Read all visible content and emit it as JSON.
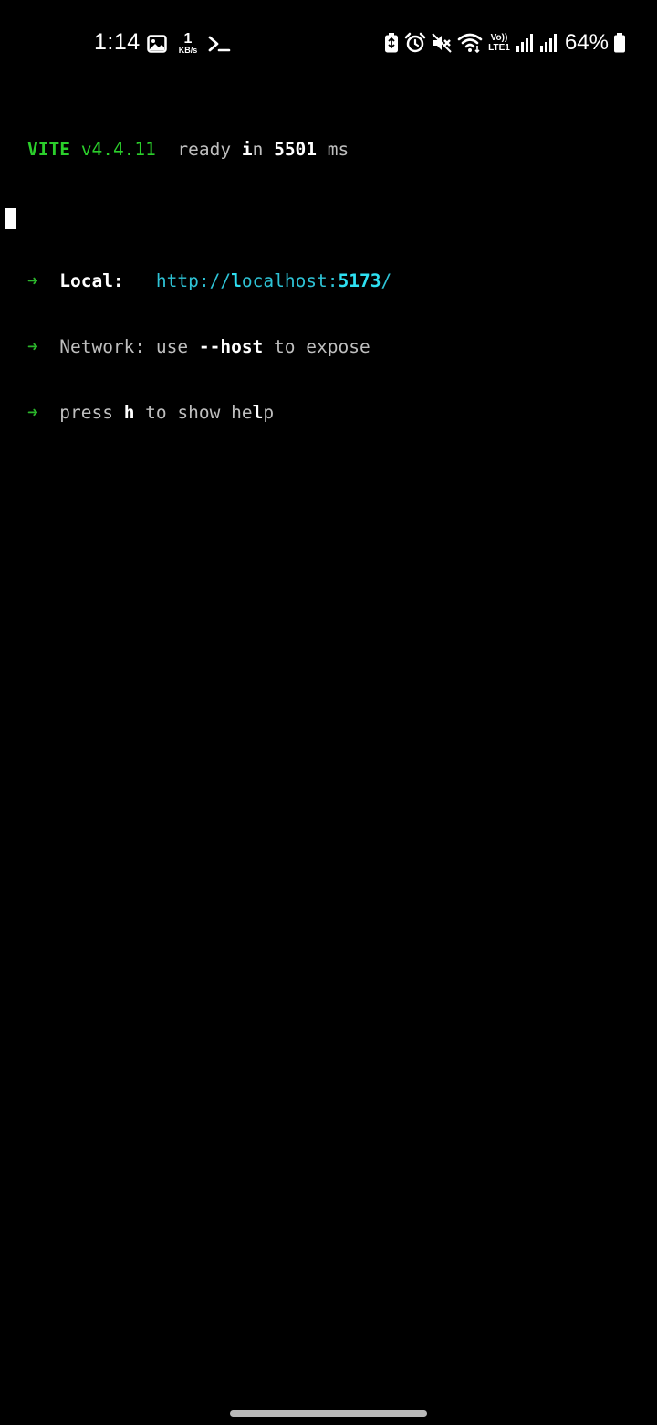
{
  "status_bar": {
    "time": "1:14",
    "net_speed_value": "1",
    "net_speed_unit": "KB/s",
    "volte_top": "Vo))",
    "volte_bottom": "LTE1",
    "battery_percent": "64%",
    "icons": [
      "gallery-icon",
      "terminal-icon",
      "battery-saver-icon",
      "alarm-icon",
      "mute-icon",
      "wifi-icon",
      "signal-icon",
      "signal-icon",
      "battery-icon"
    ]
  },
  "terminal": {
    "banner": {
      "name": "VITE",
      "version": "v4.4.11",
      "ready": "ready ",
      "in_i": "i",
      "in_n": "n ",
      "time_value": "5501",
      "time_unit": " ms"
    },
    "arrow": "➜",
    "local": {
      "label": "Local:",
      "url_prefix": "http://",
      "url_l": "l",
      "url_ocal": "ocal",
      "url_host": "host:",
      "url_port": "5173",
      "url_slash": "/"
    },
    "network": {
      "label": "Network:",
      "text_before": " use ",
      "flag": "--host",
      "text_after": " to expose"
    },
    "help": {
      "press": "press ",
      "key": "h",
      "rest_a": " to show he",
      "rest_l": "l",
      "rest_p": "p"
    }
  },
  "colors": {
    "background": "#000000",
    "green": "#2bcf2b",
    "cyan": "#2ec3d6",
    "gray": "#bfbfbf"
  }
}
